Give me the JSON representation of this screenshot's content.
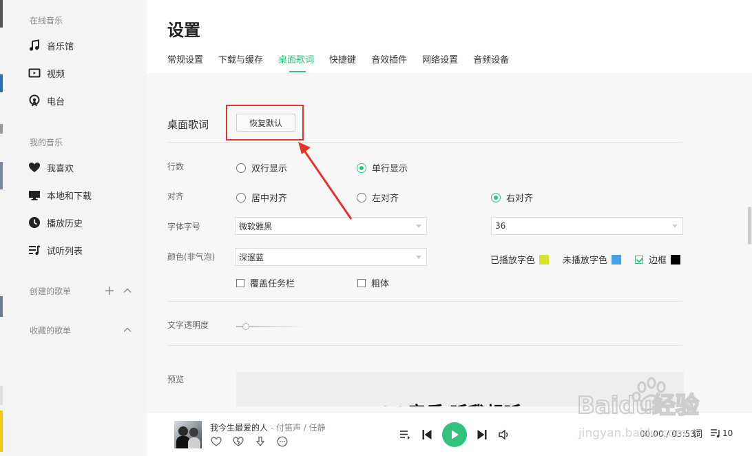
{
  "sidebar": {
    "online_title": "在线音乐",
    "online_items": [
      {
        "label": "音乐馆",
        "icon": "music-note-icon"
      },
      {
        "label": "视频",
        "icon": "video-icon"
      },
      {
        "label": "电台",
        "icon": "radio-icon"
      }
    ],
    "my_title": "我的音乐",
    "my_items": [
      {
        "label": "我喜欢",
        "icon": "heart-icon"
      },
      {
        "label": "本地和下载",
        "icon": "monitor-icon"
      },
      {
        "label": "播放历史",
        "icon": "clock-icon"
      },
      {
        "label": "试听列表",
        "icon": "playlist-icon"
      }
    ],
    "created_title": "创建的歌单",
    "collected_title": "收藏的歌单"
  },
  "settings": {
    "title": "设置",
    "tabs": [
      "常规设置",
      "下载与缓存",
      "桌面歌词",
      "快捷键",
      "音效插件",
      "网络设置",
      "音频设备"
    ],
    "active_tab": 2,
    "section_title": "桌面歌词",
    "reset_label": "恢复默认",
    "rows": {
      "lines": {
        "label": "行数",
        "options": [
          "双行显示",
          "单行显示"
        ],
        "selected": 1
      },
      "align": {
        "label": "对齐",
        "options": [
          "居中对齐",
          "左对齐",
          "右对齐"
        ],
        "selected": 2
      },
      "font": {
        "label": "字体字号",
        "family": "微软雅黑",
        "size": "36"
      },
      "color": {
        "label": "颜色(非气泡)",
        "scheme": "深邃蓝",
        "played_label": "已播放字色",
        "played_color": "#d6e32a",
        "unplayed_label": "未播放字色",
        "unplayed_color": "#3fa4ee",
        "border_label": "边框",
        "border_checked": true,
        "border_color": "#000000"
      },
      "cover_taskbar": {
        "label": "覆盖任务栏",
        "checked": false
      },
      "bold": {
        "label": "粗体",
        "checked": false
      },
      "opacity": {
        "label": "文字透明度",
        "value": 0.1
      },
      "preview": {
        "label": "预览",
        "text": "QQ音乐 听我想听"
      }
    }
  },
  "player": {
    "song": "我今生最爱的人",
    "separator": " - ",
    "artist": "付笛声 / 任静",
    "time": "00:00 / 03:53",
    "lyric_button": "词",
    "playlist_count": "10"
  },
  "watermark": {
    "brand": "Baidu经验",
    "url": "jingyan.baidu.com"
  },
  "colors": {
    "accent": "#31c27c",
    "highlight": "#e5322d"
  }
}
